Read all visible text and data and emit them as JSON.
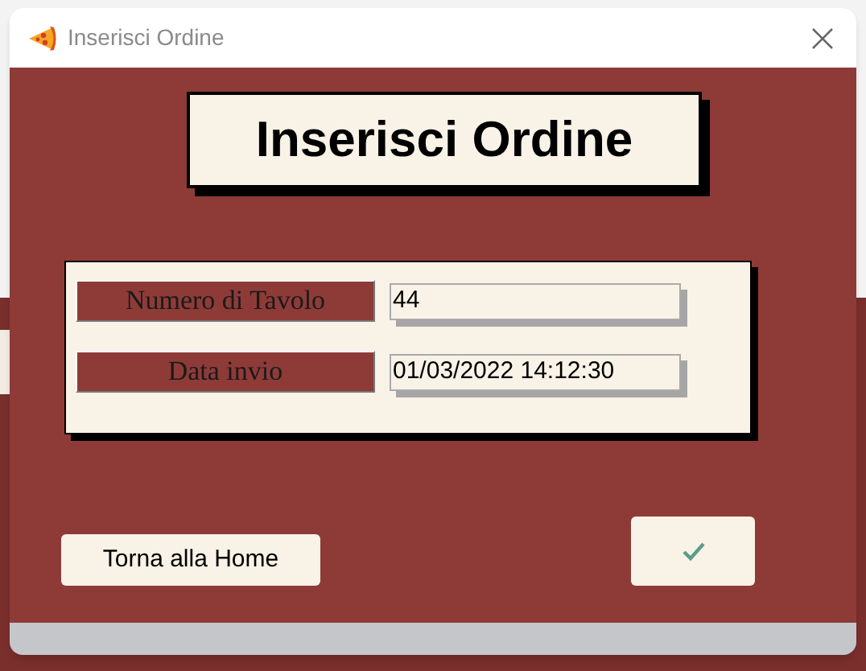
{
  "window": {
    "title": "Inserisci Ordine"
  },
  "heading": "Inserisci Ordine",
  "fields": [
    {
      "label": "Numero di Tavolo",
      "value": "44"
    },
    {
      "label": "Data invio",
      "value": "01/03/2022 14:12:30"
    }
  ],
  "buttons": [
    {
      "kind": "text",
      "label": "Torna alla Home"
    },
    {
      "kind": "confirm"
    }
  ]
}
